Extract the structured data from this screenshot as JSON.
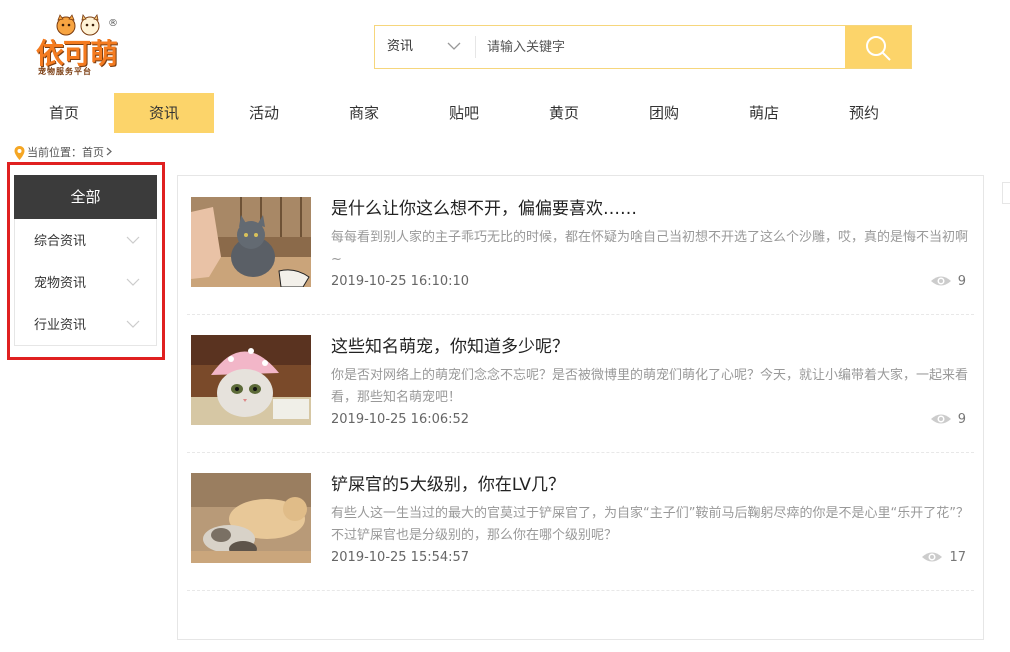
{
  "logo": {
    "main": "依可萌",
    "sub": "宠物服务平台",
    "reg": "®"
  },
  "search": {
    "type_label": "资讯",
    "placeholder": "请输入关键字",
    "value": ""
  },
  "nav": [
    {
      "label": "首页"
    },
    {
      "label": "资讯",
      "active": true
    },
    {
      "label": "活动"
    },
    {
      "label": "商家"
    },
    {
      "label": "贴吧"
    },
    {
      "label": "黄页"
    },
    {
      "label": "团购"
    },
    {
      "label": "萌店"
    },
    {
      "label": "预约"
    }
  ],
  "breadcrumb": {
    "prefix": "当前位置：",
    "current": "首页"
  },
  "sidebar": {
    "all_label": "全部",
    "items": [
      {
        "label": "综合资讯"
      },
      {
        "label": "宠物资讯"
      },
      {
        "label": "行业资讯"
      }
    ]
  },
  "articles": [
    {
      "title": "是什么让你这么想不开，偏偏要喜欢……",
      "summary": "每每看到别人家的主子乖巧无比的时候，都在怀疑为啥自己当初想不开选了这么个沙雕，哎，真的是悔不当初啊~",
      "date": "2019-10-25 16:10:10",
      "views": "9"
    },
    {
      "title": "这些知名萌宠，你知道多少呢？",
      "summary": "你是否对网络上的萌宠们念念不忘呢？是否被微博里的萌宠们萌化了心呢？今天，就让小编带着大家，一起来看看，那些知名萌宠吧！",
      "date": "2019-10-25 16:06:52",
      "views": "9"
    },
    {
      "title": "铲屎官的5大级别，你在LV几？",
      "summary": "有些人这一生当过的最大的官莫过于铲屎官了，为自家“主子们”鞍前马后鞠躬尽瘁的你是不是心里“乐开了花”？不过铲屎官也是分级别的，那么你在哪个级别呢？",
      "date": "2019-10-25 15:54:57",
      "views": "17"
    }
  ],
  "colors": {
    "accent": "#fcd46a",
    "sidebar_active": "#3b3b3b",
    "highlight": "#e02020",
    "logo": "#f47b20"
  },
  "icons": {
    "search": "search-icon",
    "eye": "eye-icon",
    "pin": "location-pin-icon",
    "chevron": "chevron-down-icon"
  }
}
